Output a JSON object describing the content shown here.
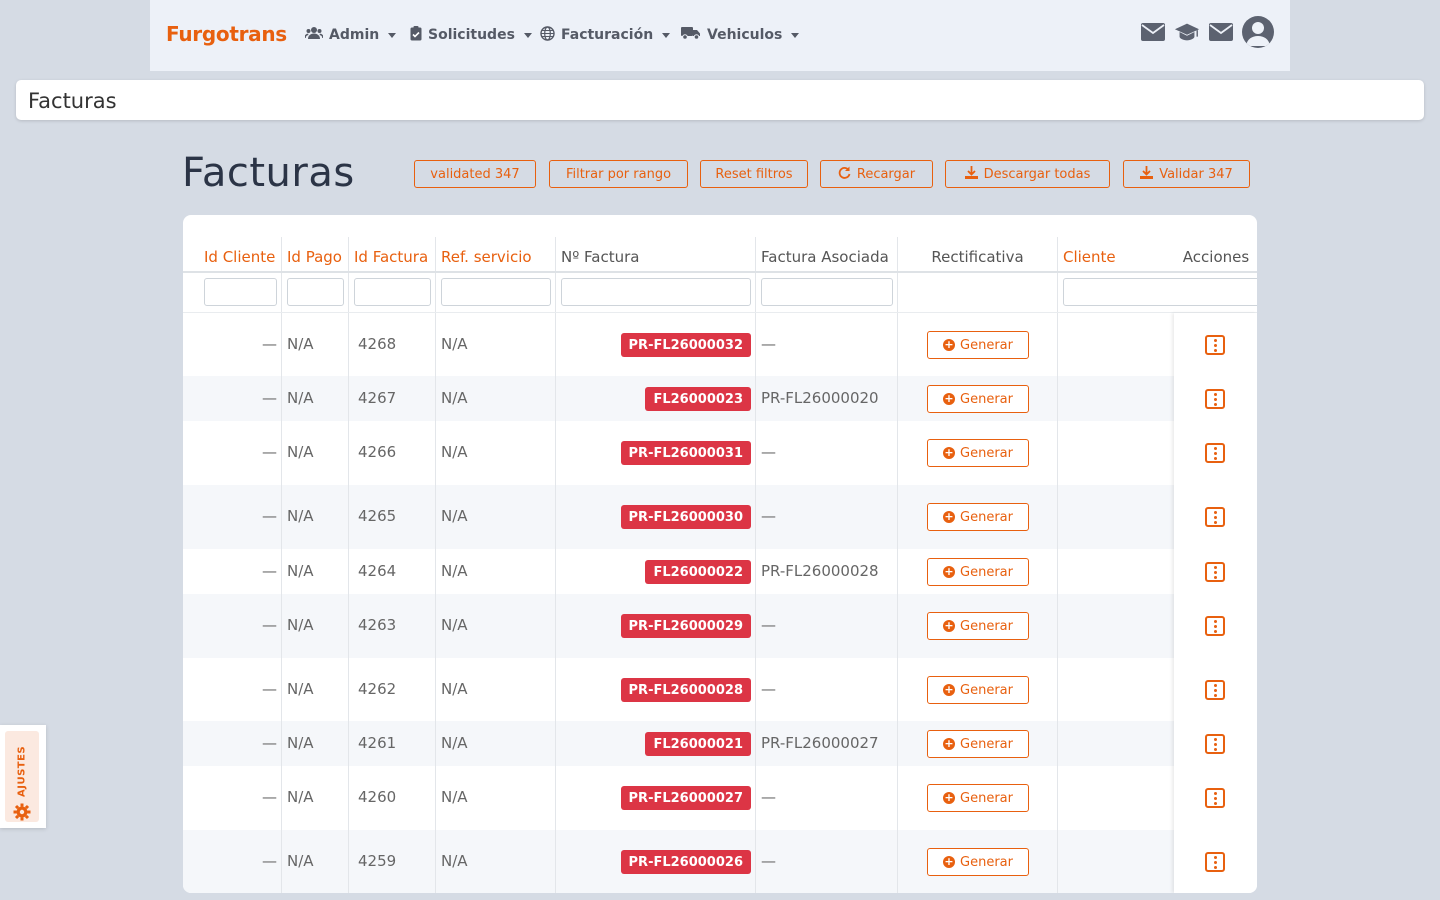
{
  "navbar": {
    "brand": "Furgotrans",
    "menu": [
      {
        "label": "Admin",
        "icon": "users-icon"
      },
      {
        "label": "Solicitudes",
        "icon": "clipboard-check-icon"
      },
      {
        "label": "Facturación",
        "icon": "globe-icon"
      },
      {
        "label": "Vehiculos",
        "icon": "truck-icon"
      }
    ],
    "right_icons": [
      "envelope-icon",
      "graduation-cap-icon",
      "envelope-icon",
      "user-avatar"
    ]
  },
  "titlebar": {
    "title": "Facturas"
  },
  "page": {
    "heading": "Facturas"
  },
  "toolbar": {
    "validated_label": "validated 347",
    "filter_range_label": "Filtrar por rango",
    "reset_filters_label": "Reset filtros",
    "reload_label": "Recargar",
    "download_all_label": "Descargar todas",
    "validate_label": "Validar 347"
  },
  "table": {
    "columns": [
      "Id Cliente",
      "Id Pago",
      "Id Factura",
      "Ref. servicio",
      "Nº Factura",
      "Factura Asociada",
      "Rectificativa",
      "Cliente",
      "Acciones"
    ],
    "generate_label": "Generar",
    "rows": [
      {
        "id_cliente": "—",
        "id_pago": "N/A",
        "id_factura": "4268",
        "ref_servicio": "N/A",
        "num_factura": "PR-FL26000032",
        "asociada": "—"
      },
      {
        "id_cliente": "—",
        "id_pago": "N/A",
        "id_factura": "4267",
        "ref_servicio": "N/A",
        "num_factura": "FL26000023",
        "asociada": "PR-FL26000020"
      },
      {
        "id_cliente": "—",
        "id_pago": "N/A",
        "id_factura": "4266",
        "ref_servicio": "N/A",
        "num_factura": "PR-FL26000031",
        "asociada": "—"
      },
      {
        "id_cliente": "—",
        "id_pago": "N/A",
        "id_factura": "4265",
        "ref_servicio": "N/A",
        "num_factura": "PR-FL26000030",
        "asociada": "—"
      },
      {
        "id_cliente": "—",
        "id_pago": "N/A",
        "id_factura": "4264",
        "ref_servicio": "N/A",
        "num_factura": "FL26000022",
        "asociada": "PR-FL26000028"
      },
      {
        "id_cliente": "—",
        "id_pago": "N/A",
        "id_factura": "4263",
        "ref_servicio": "N/A",
        "num_factura": "PR-FL26000029",
        "asociada": "—"
      },
      {
        "id_cliente": "—",
        "id_pago": "N/A",
        "id_factura": "4262",
        "ref_servicio": "N/A",
        "num_factura": "PR-FL26000028",
        "asociada": "—"
      },
      {
        "id_cliente": "—",
        "id_pago": "N/A",
        "id_factura": "4261",
        "ref_servicio": "N/A",
        "num_factura": "FL26000021",
        "asociada": "PR-FL26000027"
      },
      {
        "id_cliente": "—",
        "id_pago": "N/A",
        "id_factura": "4260",
        "ref_servicio": "N/A",
        "num_factura": "PR-FL26000027",
        "asociada": "—"
      },
      {
        "id_cliente": "—",
        "id_pago": "N/A",
        "id_factura": "4259",
        "ref_servicio": "N/A",
        "num_factura": "PR-FL26000026",
        "asociada": "—"
      }
    ]
  },
  "settings_tab": {
    "label": "AJUSTES"
  },
  "colors": {
    "accent": "#e8600f",
    "badge": "#dc3545",
    "heading": "#2b3446",
    "background": "#d5dbe4"
  }
}
